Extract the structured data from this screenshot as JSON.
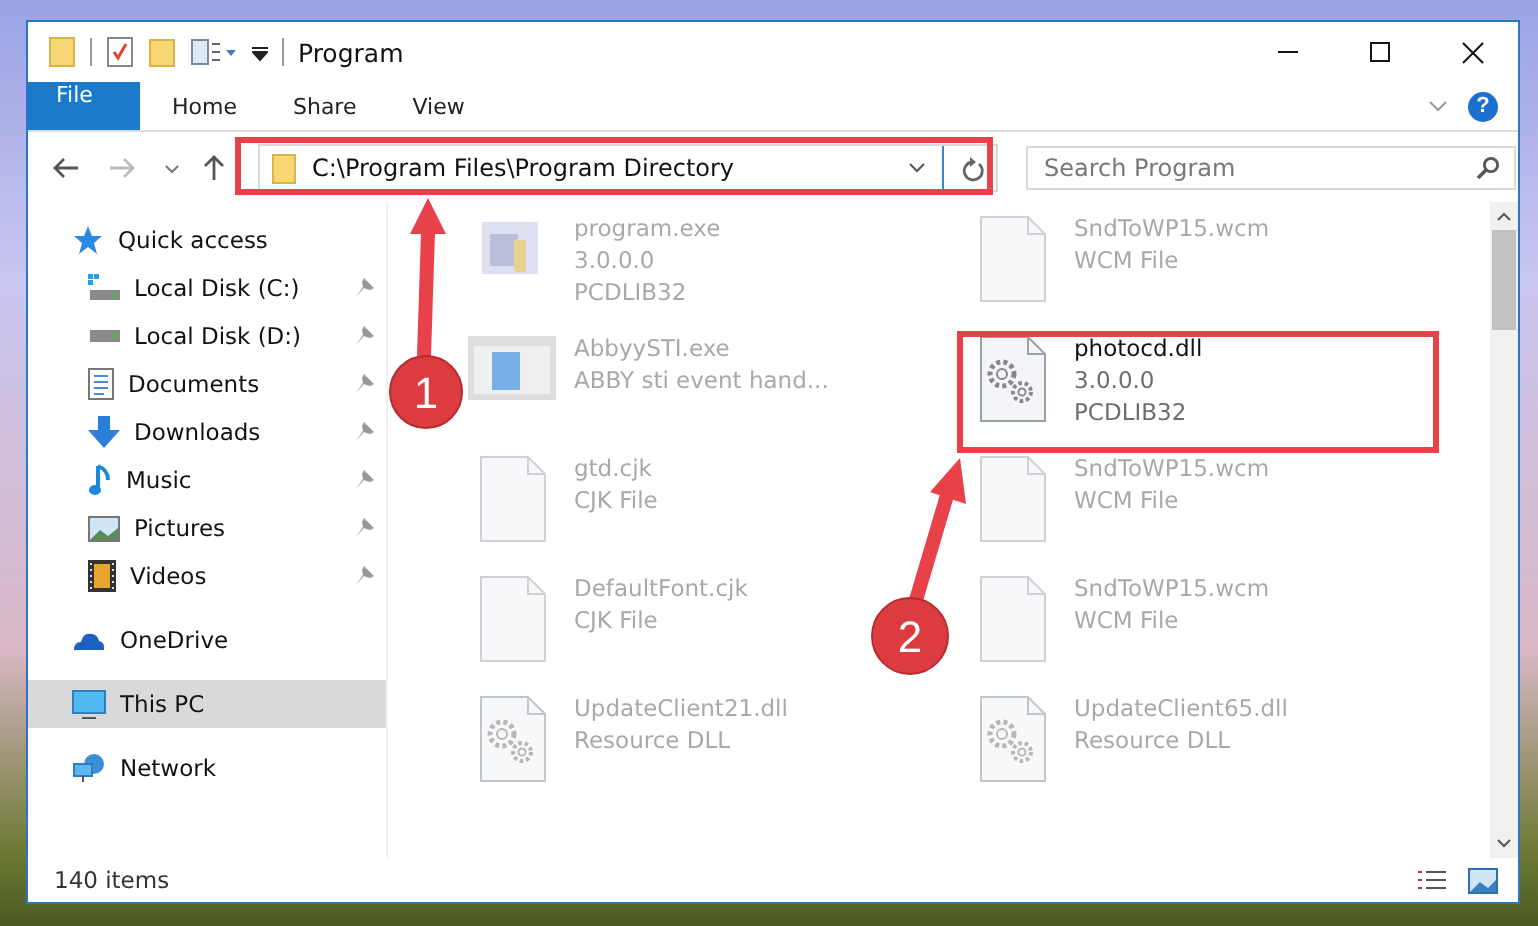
{
  "window": {
    "title": "Program"
  },
  "ribbon_tabs": [
    {
      "label": "File",
      "kind": "file"
    },
    {
      "label": "Home",
      "kind": "tab"
    },
    {
      "label": "Share",
      "kind": "tab"
    },
    {
      "label": "View",
      "kind": "tab"
    }
  ],
  "help": {
    "label": "?"
  },
  "address_bar": {
    "path": "C:\\Program Files\\Program Directory"
  },
  "search": {
    "placeholder": "Search Program"
  },
  "sidebar": {
    "items": [
      {
        "label": "Quick access",
        "kind": "star",
        "selected": false,
        "children": [
          {
            "label": "Local Disk (C:)",
            "kind": "system-drive",
            "pinned": true,
            "selected": false
          },
          {
            "label": "Local Disk (D:)",
            "kind": "drive",
            "pinned": true,
            "selected": false
          },
          {
            "label": "Documents",
            "kind": "document",
            "pinned": true,
            "selected": false
          },
          {
            "label": "Downloads",
            "kind": "download",
            "pinned": true,
            "selected": false
          },
          {
            "label": "Music",
            "kind": "music",
            "pinned": true,
            "selected": false
          },
          {
            "label": "Pictures",
            "kind": "picture",
            "pinned": true,
            "selected": false
          },
          {
            "label": "Videos",
            "kind": "video",
            "pinned": true,
            "selected": false
          }
        ]
      },
      {
        "label": "OneDrive",
        "kind": "cloud",
        "selected": false
      },
      {
        "label": "This PC",
        "kind": "computer",
        "selected": true
      },
      {
        "label": "Network",
        "kind": "network",
        "selected": false
      }
    ]
  },
  "files": [
    {
      "name": "program.exe",
      "details": [
        "3.0.0.0",
        "PCDLIB32"
      ],
      "kind": "app",
      "dimmed": true
    },
    {
      "name": "SndToWP15.wcm",
      "details": [
        "WCM File"
      ],
      "kind": "blank",
      "dimmed": true
    },
    {
      "name": "AbbyySTI.exe",
      "details": [
        "ABBY sti event hand..."
      ],
      "kind": "window",
      "dimmed": true
    },
    {
      "name": "photocd.dll",
      "details": [
        "3.0.0.0",
        "PCDLIB32"
      ],
      "kind": "dll",
      "dimmed": false
    },
    {
      "name": "gtd.cjk",
      "details": [
        "CJK File"
      ],
      "kind": "blank",
      "dimmed": true
    },
    {
      "name": "SndToWP15.wcm",
      "details": [
        "WCM File"
      ],
      "kind": "blank",
      "dimmed": true
    },
    {
      "name": "DefaultFont.cjk",
      "details": [
        "CJK File"
      ],
      "kind": "blank",
      "dimmed": true
    },
    {
      "name": "SndToWP15.wcm",
      "details": [
        "WCM File"
      ],
      "kind": "blank",
      "dimmed": true
    },
    {
      "name": "UpdateClient21.dll",
      "details": [
        "Resource DLL"
      ],
      "kind": "dll",
      "dimmed": true
    },
    {
      "name": "UpdateClient65.dll",
      "details": [
        "Resource DLL"
      ],
      "kind": "dll",
      "dimmed": true
    }
  ],
  "status_bar": {
    "item_count": "140 items"
  },
  "annotations": [
    {
      "label": "1"
    },
    {
      "label": "2"
    }
  ]
}
